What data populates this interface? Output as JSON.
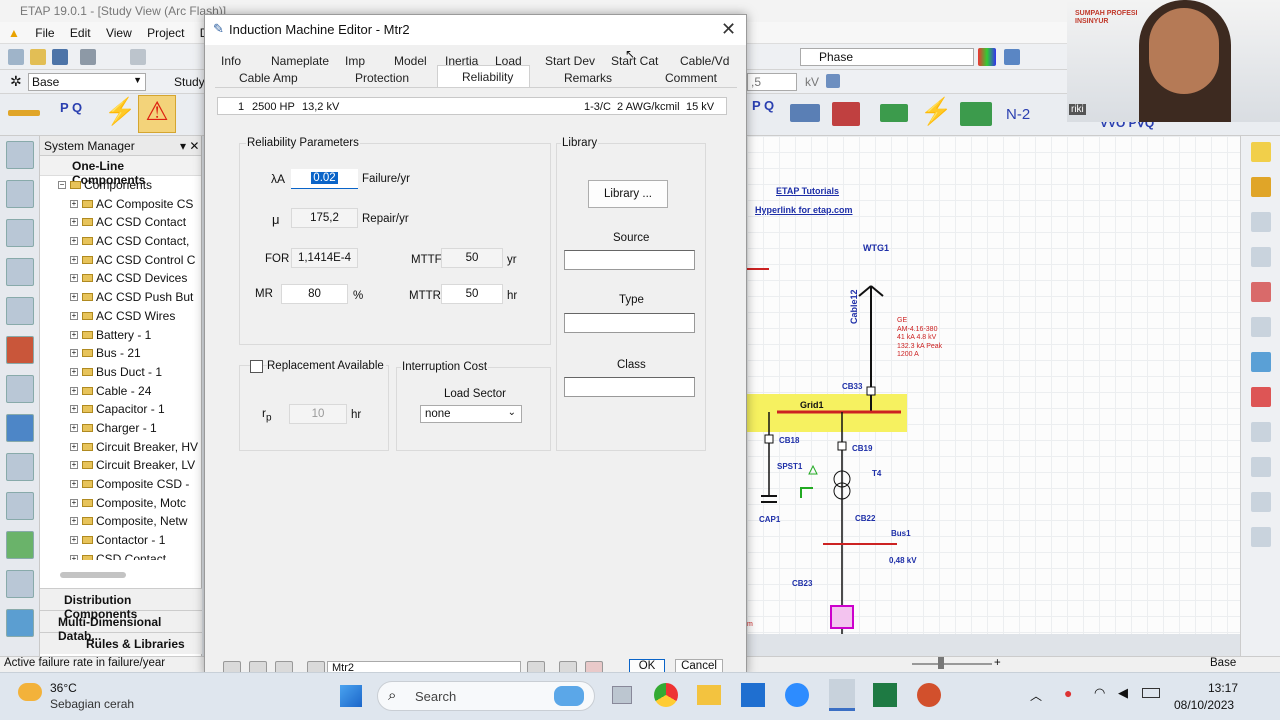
{
  "app": {
    "title": "ETAP 19.0.1 - [Study View (Arc Flash)]",
    "menu": [
      "File",
      "Edit",
      "View",
      "Project",
      "Default"
    ],
    "config_value": "Base",
    "study_label": "Study",
    "phase_value": "Phase",
    "kv_field": ",5",
    "kv_unit": "kV",
    "n2_label": "N-2"
  },
  "system_manager": {
    "title": "System Manager",
    "one_line": "One-Line Components",
    "components": "Components",
    "items": [
      "AC Composite CS",
      "AC CSD Contact",
      "AC CSD Contact,",
      "AC CSD Control C",
      "AC CSD Devices",
      "AC CSD Push But",
      "AC CSD Wires",
      "Battery - 1",
      "Bus - 21",
      "Bus Duct - 1",
      "Cable - 24",
      "Capacitor - 1",
      "Charger - 1",
      "Circuit Breaker, HV",
      "Circuit Breaker, LV",
      "Composite CSD -",
      "Composite, Motc",
      "Composite, Netw",
      "Contactor - 1",
      "CSD Contact"
    ],
    "sections": [
      "Distribution Components",
      "Multi-Dimensional Datab...",
      "Rules & Libraries"
    ]
  },
  "status": {
    "text": "Active failure rate in failure/year",
    "right": "Base"
  },
  "dialog": {
    "title": "Induction Machine Editor - Mtr2",
    "tabs_row1": [
      "Info",
      "Nameplate",
      "Imp",
      "Model",
      "Inertia",
      "Load",
      "Start Dev",
      "Start Cat",
      "Cable/Vd"
    ],
    "tabs_row2": [
      "Cable Amp",
      "Protection",
      "Reliability",
      "Remarks",
      "Comment"
    ],
    "info_line": {
      "qty": "1",
      "hp": "2500 HP",
      "kv": "13,2 kV",
      "config": "1-3/C",
      "awg": "2 AWG/kcmil",
      "rating": "15 kV"
    },
    "reliability": {
      "title": "Reliability Parameters",
      "lambda_symbol": "λA",
      "lambda": "0.02",
      "lambda_unit": "Failure/yr",
      "mu_symbol": "μ",
      "mu": "175,2",
      "mu_unit": "Repair/yr",
      "for_label": "FOR",
      "for": "1,1414E-4",
      "mttf_label": "MTTF",
      "mttf": "50",
      "mttf_unit": "yr",
      "mr_label": "MR",
      "mr": "80",
      "mr_unit": "%",
      "mttr_label": "MTTR",
      "mttr": "50",
      "mttr_unit": "hr"
    },
    "replacement": {
      "label": "Replacement Available",
      "rp_symbol": "r",
      "rp_sub": "p",
      "rp": "10",
      "rp_unit": "hr"
    },
    "interruption": {
      "title": "Interruption Cost",
      "sector_label": "Load Sector",
      "sector_value": "none"
    },
    "library": {
      "title": "Library",
      "button": "Library ...",
      "source": "Source",
      "type": "Type",
      "class": "Class"
    },
    "footer": {
      "id": "Mtr2",
      "ok": "OK",
      "cancel": "Cancel"
    }
  },
  "diagram": {
    "tutorials": "ETAP Tutorials",
    "hyperlink": "Hyperlink for etap.com",
    "wtg": "WTG1",
    "cable": "Cable12",
    "ge_note": [
      "GE",
      "AM-4.16-380",
      "41  kA    4.8  kV",
      "132.3  kA  Peak",
      "1200  A"
    ],
    "cb33": "CB33",
    "grid": "Grid1",
    "cb18": "CB18",
    "cb19": "CB19",
    "spst": "SPST1",
    "t4": "T4",
    "cap": "CAP1",
    "cb22": "CB22",
    "bus": "Bus1",
    "bus_kv": "0,48 kV",
    "cb23": "CB23",
    "edge_note": "m"
  },
  "webcam": {
    "banner1": "SUMPAH PROFESI",
    "banner2": "INSINYUR",
    "name": "riki"
  },
  "taskbar": {
    "weather_temp": "36°C",
    "weather_desc": "Sebagian cerah",
    "search": "Search",
    "time": "13:17",
    "date": "08/10/2023"
  }
}
